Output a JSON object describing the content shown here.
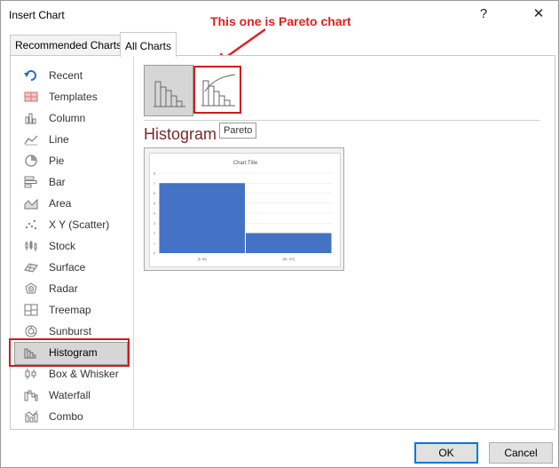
{
  "window": {
    "title": "Insert Chart",
    "help_label": "?",
    "close_label": "✕"
  },
  "annotation": {
    "text": "This one is Pareto chart"
  },
  "tabs": [
    {
      "label": "Recommended Charts",
      "active": false
    },
    {
      "label": "All Charts",
      "active": true
    }
  ],
  "sidebar": {
    "items": [
      {
        "label": "Recent",
        "icon": "undo-arrow-icon"
      },
      {
        "label": "Templates",
        "icon": "templates-icon"
      },
      {
        "label": "Column",
        "icon": "column-chart-icon"
      },
      {
        "label": "Line",
        "icon": "line-chart-icon"
      },
      {
        "label": "Pie",
        "icon": "pie-chart-icon"
      },
      {
        "label": "Bar",
        "icon": "bar-chart-icon"
      },
      {
        "label": "Area",
        "icon": "area-chart-icon"
      },
      {
        "label": "X Y (Scatter)",
        "icon": "scatter-chart-icon"
      },
      {
        "label": "Stock",
        "icon": "stock-chart-icon"
      },
      {
        "label": "Surface",
        "icon": "surface-chart-icon"
      },
      {
        "label": "Radar",
        "icon": "radar-chart-icon"
      },
      {
        "label": "Treemap",
        "icon": "treemap-chart-icon"
      },
      {
        "label": "Sunburst",
        "icon": "sunburst-chart-icon"
      },
      {
        "label": "Histogram",
        "icon": "histogram-chart-icon",
        "selected": true
      },
      {
        "label": "Box & Whisker",
        "icon": "box-whisker-chart-icon"
      },
      {
        "label": "Waterfall",
        "icon": "waterfall-chart-icon"
      },
      {
        "label": "Combo",
        "icon": "combo-chart-icon"
      }
    ]
  },
  "main": {
    "subtypes": [
      {
        "icon": "histogram-subtype-icon",
        "selected": true
      },
      {
        "icon": "pareto-subtype-icon",
        "selected": false
      }
    ],
    "section_title": "Histogram",
    "tooltip": "Pareto"
  },
  "chart_data": {
    "type": "bar",
    "title": "Chart Title",
    "categories": [
      "[5, 56]",
      "(56, 107]"
    ],
    "values": [
      7,
      2
    ],
    "ylim": [
      0,
      8
    ],
    "yticks": [
      "0",
      "1",
      "2",
      "3",
      "4",
      "5",
      "6",
      "7",
      "8"
    ],
    "bar_color": "#4472c4",
    "grid": true
  },
  "buttons": {
    "ok_label": "OK",
    "cancel_label": "Cancel"
  },
  "colors": {
    "annotation": "#e02020",
    "highlight_box": "#d01a1a",
    "histogram_title": "#7a2a2a",
    "bar": "#4472c4"
  }
}
